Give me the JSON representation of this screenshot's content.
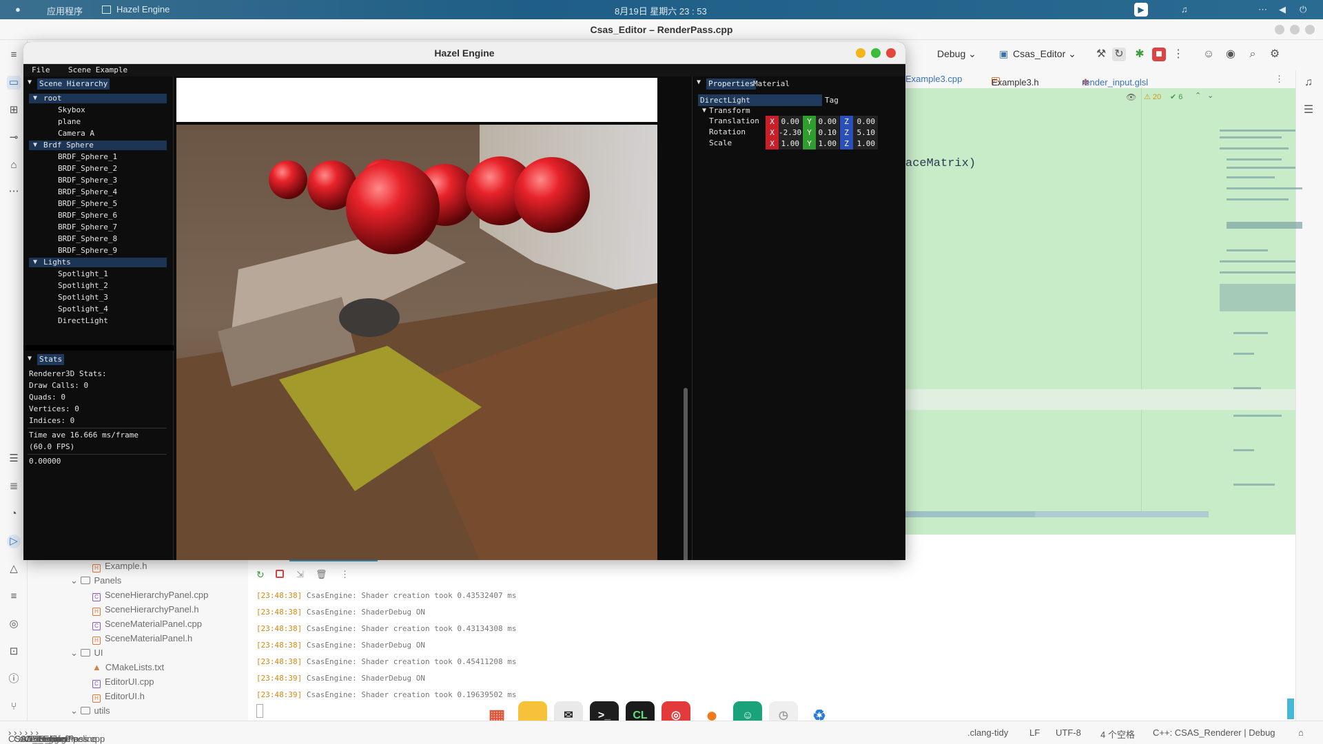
{
  "topbar": {
    "apps": "应用程序",
    "app": "Hazel Engine",
    "datetime": "8月19日 星期六 23 : 53"
  },
  "ide": {
    "window_title": "Csas_Editor – RenderPass.cpp",
    "toolbar": {
      "config": "Debug",
      "target": "Csas_Editor"
    },
    "tabs": [
      "Example3.cpp",
      "Example3.h",
      "render_input.glsl"
    ],
    "inspection": {
      "warnings": "20",
      "checks": "6"
    },
    "code_fragment": "aceMatrix)",
    "project_tree": [
      {
        "label": "Example.h",
        "kind": "header"
      },
      {
        "label": "Panels",
        "kind": "folder"
      },
      {
        "label": "SceneHierarchyPanel.cpp",
        "kind": "cpp"
      },
      {
        "label": "SceneHierarchyPanel.h",
        "kind": "header"
      },
      {
        "label": "SceneMaterialPanel.cpp",
        "kind": "cpp"
      },
      {
        "label": "SceneMaterialPanel.h",
        "kind": "header"
      },
      {
        "label": "UI",
        "kind": "folder"
      },
      {
        "label": "CMakeLists.txt",
        "kind": "cmake"
      },
      {
        "label": "EditorUI.cpp",
        "kind": "cpp"
      },
      {
        "label": "EditorUI.h",
        "kind": "header"
      },
      {
        "label": "utils",
        "kind": "folder"
      }
    ],
    "console_lines": [
      {
        "ts": "[23:48:38]",
        "msg": "CsasEngine: Shader creation took 0.43532407 ms"
      },
      {
        "ts": "[23:48:38]",
        "msg": "CsasEngine: ShaderDebug ON"
      },
      {
        "ts": "[23:48:38]",
        "msg": "CsasEngine: Shader creation took 0.43134308 ms"
      },
      {
        "ts": "[23:48:38]",
        "msg": "CsasEngine: ShaderDebug ON"
      },
      {
        "ts": "[23:48:38]",
        "msg": "CsasEngine: Shader creation took 0.45411208 ms"
      },
      {
        "ts": "[23:48:39]",
        "msg": "CsasEngine: ShaderDebug ON"
      },
      {
        "ts": "[23:48:39]",
        "msg": "CsasEngine: Shader creation took 0.19639502 ms"
      }
    ],
    "breadcrumb": [
      "CSAS_Engine",
      "CSAS_Engine",
      "src",
      "Csas_Engine",
      "Renderer",
      "RenderPipeline",
      "RenderPass.cpp"
    ],
    "status": {
      "linter": ".clang-tidy",
      "eol": "LF",
      "encoding": "UTF-8",
      "indent": "4 个空格",
      "context": "C++: CSAS_Renderer | Debug"
    }
  },
  "hazel": {
    "title": "Hazel Engine",
    "menu": [
      "File",
      "Scene Example"
    ],
    "hierarchy": {
      "header": "Scene Hierarchy",
      "groups": [
        {
          "name": "root",
          "children": [
            "Skybox",
            "plane",
            "Camera A"
          ]
        },
        {
          "name": "Brdf Sphere",
          "children": [
            "BRDF_Sphere_1",
            "BRDF_Sphere_2",
            "BRDF_Sphere_3",
            "BRDF_Sphere_4",
            "BRDF_Sphere_5",
            "BRDF_Sphere_6",
            "BRDF_Sphere_7",
            "BRDF_Sphere_8",
            "BRDF_Sphere_9"
          ]
        },
        {
          "name": "Lights",
          "children": [
            "Spotlight_1",
            "Spotlight_2",
            "Spotlight_3",
            "Spotlight_4",
            "DirectLight"
          ]
        }
      ]
    },
    "stats": {
      "header": "Stats",
      "title": "Renderer3D Stats:",
      "draw_calls": "Draw Calls: 0",
      "quads": "Quads: 0",
      "vertices": "Vertices: 0",
      "indices": "Indices: 0",
      "time": "Time ave 16.666 ms/frame",
      "fps": "(60.0 FPS)",
      "value": "0.00000"
    },
    "properties": {
      "tabs": [
        "Properties",
        "Material"
      ],
      "entity_name": "DirectLight",
      "tag_label": "Tag",
      "transform_label": "Transform",
      "rows": [
        {
          "label": "Translation",
          "x": "0.00",
          "y": "0.00",
          "z": "0.00"
        },
        {
          "label": "Rotation",
          "x": "-2.30",
          "y": "0.10",
          "z": "5.10"
        },
        {
          "label": "Scale",
          "x": "1.00",
          "y": "1.00",
          "z": "1.00"
        }
      ]
    }
  },
  "colors": {
    "axis_x": "#c8202a",
    "axis_y": "#2f9e2f",
    "axis_z": "#2a4fb8",
    "editor_bg": "#c9ecc8",
    "header_blue": "#1f3a5c"
  }
}
